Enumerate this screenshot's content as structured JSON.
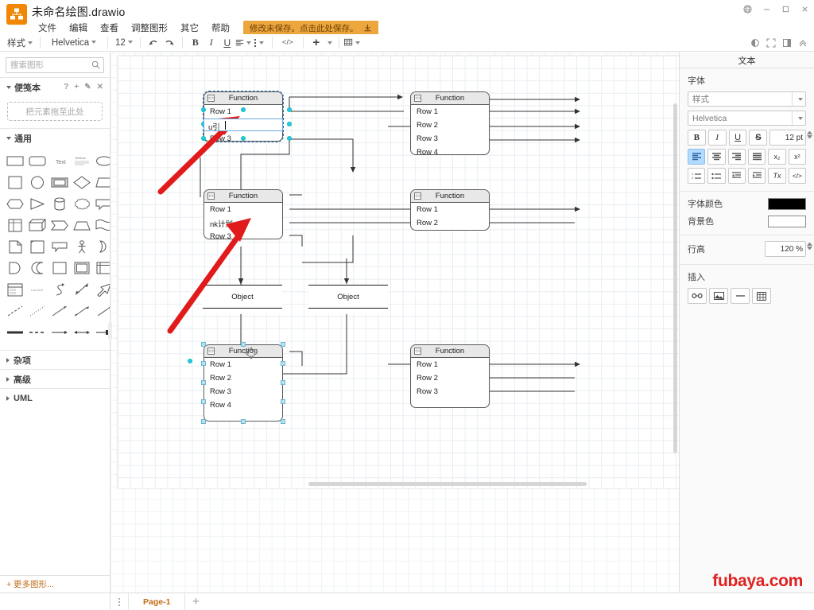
{
  "window": {
    "title": "未命名绘图.drawio",
    "controls": [
      {
        "name": "language-globe",
        "glyph": "globe"
      },
      {
        "name": "minimize",
        "glyph": "minimize"
      },
      {
        "name": "maximize",
        "glyph": "maximize"
      },
      {
        "name": "close",
        "glyph": "close"
      }
    ]
  },
  "menubar": {
    "items": [
      "文件",
      "编辑",
      "查看",
      "调整图形",
      "其它",
      "帮助"
    ],
    "save_badge": "修改未保存。点击此处保存。"
  },
  "toolbar": {
    "style_label": "样式",
    "font_family": "Helvetica",
    "font_size": "12",
    "buttons": [
      {
        "name": "undo",
        "label": "↶"
      },
      {
        "name": "redo",
        "label": "↷"
      },
      {
        "name": "bold",
        "label": "B"
      },
      {
        "name": "italic",
        "label": "I"
      },
      {
        "name": "underline",
        "label": "U"
      },
      {
        "name": "align",
        "label": "≡"
      },
      {
        "name": "more-vert",
        "label": "⋮"
      },
      {
        "name": "code",
        "label": "</>"
      },
      {
        "name": "insert",
        "label": "+"
      },
      {
        "name": "table",
        "label": "▦"
      }
    ],
    "right_buttons": [
      {
        "name": "dark-mode",
        "label": "◗"
      },
      {
        "name": "fullscreen",
        "label": "⛶"
      },
      {
        "name": "format-panel",
        "label": "▣"
      },
      {
        "name": "collapse",
        "label": "⌃"
      }
    ]
  },
  "sidebar": {
    "search_placeholder": "搜索图形",
    "sections": [
      {
        "name": "scratchpad",
        "label": "便笺本",
        "open": true,
        "tools": [
          "?",
          "+",
          "✎",
          "✕"
        ],
        "drop_hint": "把元素拖至此处"
      },
      {
        "name": "general",
        "label": "通用",
        "open": true
      },
      {
        "name": "misc",
        "label": "杂项",
        "open": false
      },
      {
        "name": "advanced",
        "label": "高级",
        "open": false
      },
      {
        "name": "uml",
        "label": "UML",
        "open": false
      }
    ],
    "more_shapes": "+ 更多图形..."
  },
  "format_panel": {
    "title": "文本",
    "font_group_label": "字体",
    "style_placeholder": "样式",
    "font_family": "Helvetica",
    "font_size": "12 pt",
    "text_buttons": [
      {
        "name": "bold",
        "label": "B"
      },
      {
        "name": "italic",
        "label": "I"
      },
      {
        "name": "underline",
        "label": "U"
      },
      {
        "name": "strikethrough",
        "label": "S"
      }
    ],
    "align_buttons": [
      {
        "name": "align-left",
        "label": "▤",
        "active": true
      },
      {
        "name": "align-center",
        "label": "▤",
        "active": false
      },
      {
        "name": "align-right",
        "label": "▤",
        "active": false
      },
      {
        "name": "align-justify",
        "label": "▤",
        "active": false
      }
    ],
    "script_buttons": [
      {
        "name": "subscript",
        "label": "x₂"
      },
      {
        "name": "superscript",
        "label": "x²"
      }
    ],
    "list_buttons": [
      {
        "name": "numbered-list",
        "label": "≔"
      },
      {
        "name": "bulleted-list",
        "label": "≡"
      },
      {
        "name": "outdent",
        "label": "⇤"
      },
      {
        "name": "indent",
        "label": "⇥"
      }
    ],
    "extra_buttons": [
      {
        "name": "clear-formatting",
        "label": "Tx"
      },
      {
        "name": "edit-html",
        "label": "</>"
      }
    ],
    "font_color_label": "字体颜色",
    "font_color_value": "#000000",
    "background_color_label": "背景色",
    "background_color_value": "#ffffff",
    "line_height_label": "行高",
    "line_height_value": "120 %",
    "insert_label": "插入",
    "insert_buttons": [
      {
        "name": "insert-link",
        "label": "🔗"
      },
      {
        "name": "insert-image",
        "label": "🖼"
      },
      {
        "name": "insert-hr",
        "label": "—"
      },
      {
        "name": "insert-table",
        "label": "▦"
      }
    ]
  },
  "diagram": {
    "shapes": [
      {
        "id": "func-1",
        "type": "function",
        "title": "Function",
        "rows": [
          "Row 1",
          "u引",
          "Row 3"
        ],
        "selected": true,
        "editing_row": 1
      },
      {
        "id": "func-2",
        "type": "function",
        "title": "Function",
        "rows": [
          "Row 1",
          "Row 2",
          "Row 3",
          "Row 4"
        ],
        "selected": false
      },
      {
        "id": "func-3",
        "type": "function",
        "title": "Function",
        "rows": [
          "Row 1",
          "nk计划",
          "Row 3"
        ],
        "selected": false
      },
      {
        "id": "func-4",
        "type": "function",
        "title": "Function",
        "rows": [
          "Row 1",
          "Row 2"
        ],
        "selected": false
      },
      {
        "id": "obj-1",
        "type": "object",
        "title": "Object"
      },
      {
        "id": "obj-2",
        "type": "object",
        "title": "Object"
      },
      {
        "id": "func-5",
        "type": "function",
        "title": "Function",
        "rows": [
          "Row 1",
          "Row 2",
          "Row 3",
          "Row 4"
        ],
        "selected": true
      },
      {
        "id": "func-6",
        "type": "function",
        "title": "Function",
        "rows": [
          "Row 1",
          "Row 2",
          "Row 3"
        ],
        "selected": false
      }
    ]
  },
  "bottombar": {
    "page_menu_icon": "⋮",
    "page_tab": "Page-1",
    "add_page": "+"
  },
  "watermark": "fubaya.com"
}
